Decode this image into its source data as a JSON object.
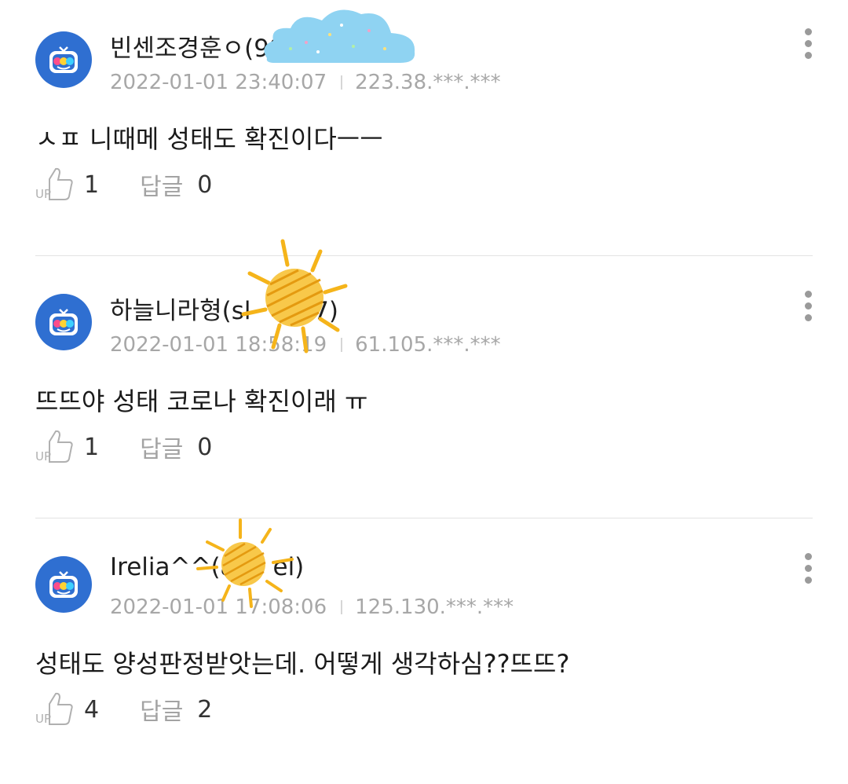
{
  "comments": [
    {
      "nickname": "빈센조경훈ㅇ(99",
      "date": "2022-01-01 23:40:07",
      "ip": "223.38.***.***",
      "text": "ㅅㅍ 니때메 성태도 확진이다ㅡㅡ",
      "up_count": "1",
      "reply_label": "답글",
      "reply_count": "0",
      "sticker": "cloud-sticker"
    },
    {
      "nickname": "하늘니라형(sl",
      "nickname_tail": "d7)",
      "date": "2022-01-01 18:58:19",
      "ip": "61.105.***.***",
      "text": "뜨뜨야 성태 코로나 확진이래 ㅠ",
      "up_count": "1",
      "reply_label": "답글",
      "reply_count": "0",
      "sticker": "sun-sticker"
    },
    {
      "nickname": "Irelia^^(ak",
      "nickname_tail": "el)",
      "date": "2022-01-01 17:08:06",
      "ip": "125.130.***.***",
      "text": "성태도 양성판정받앗는데. 어떻게 생각하심??뜨뜨?",
      "up_count": "4",
      "reply_label": "답글",
      "reply_count": "2",
      "sticker": "sun-sticker"
    }
  ],
  "icons": {
    "avatar": "tv-character-avatar",
    "more": "more-vertical-icon",
    "up": "thumbs-up-icon"
  },
  "colors": {
    "avatar_bg": "#2f6fd1",
    "meta_text": "#a7a7a7",
    "divider": "#e3e3e3",
    "cloud_sticker": "#8fd3f2",
    "sun_sticker": "#f5b41a"
  }
}
